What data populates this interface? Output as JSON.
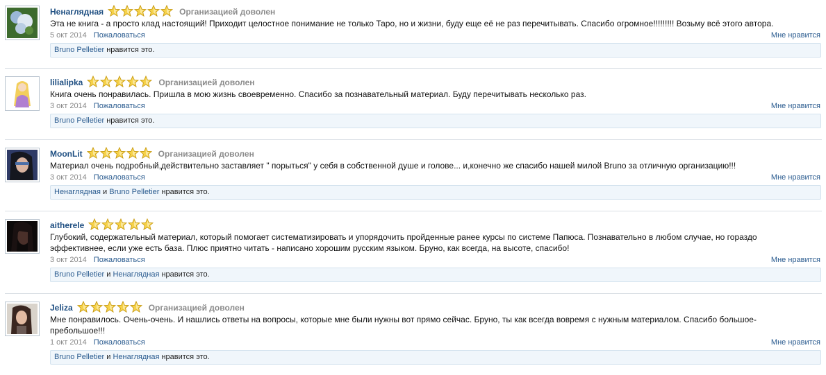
{
  "rating_word_stars": 5,
  "colors": {
    "link": "#2a5b8f",
    "username": "#1f4f82",
    "star": "#f4c430",
    "like_box_bg": "#f0f6fb"
  },
  "reviews": [
    {
      "username": "Ненаглядная",
      "rating": 5,
      "verdict": "Организацией доволен",
      "text_lines": [
        "Эта не книга - а просто клад настоящий! Приходит целостное понимание не только Таро, но и жизни, буду еще её не раз перечитывать. Спасибо огромное!!!!!!!!! Возьму всё этого автора."
      ],
      "date": "5 окт 2014",
      "report": "Пожаловаться",
      "like": "Мне нравится",
      "likers": [
        "Bruno Pelletier"
      ],
      "and": "",
      "likes_suffix": "нравится это.",
      "avatar": "flower-avatar"
    },
    {
      "username": "lilialipka",
      "rating": 5,
      "verdict": "Организацией доволен",
      "text_lines": [
        "Книга очень понравилась. Пришла в мою жизнь своевременно. Спасибо за познавательный материал. Буду перечитывать несколько раз."
      ],
      "date": "3 окт 2014",
      "report": "Пожаловаться",
      "like": "Мне нравится",
      "likers": [
        "Bruno Pelletier"
      ],
      "and": "",
      "likes_suffix": "нравится это.",
      "avatar": "princess-avatar"
    },
    {
      "username": "MoonLit",
      "rating": 5,
      "verdict": "Организацией доволен",
      "text_lines": [
        "Материал очень подробный,действительно заставляет \" порыться\" у себя в собственной душе и голове... и,конечно же спасибо нашей милой Bruno за отличную организацию!!!"
      ],
      "date": "3 окт 2014",
      "report": "Пожаловаться",
      "like": "Мне нравится",
      "likers": [
        "Ненаглядная",
        "Bruno Pelletier"
      ],
      "and": "и",
      "likes_suffix": "нравится это.",
      "avatar": "fantasy-avatar"
    },
    {
      "username": "aitherele",
      "rating": 5,
      "verdict": "",
      "text_lines": [
        "Глубокий, содержательный материал, который помогает систематизировать и упорядочить пройденные ранее курсы по системе Папюса. Познавательно в любом случае, но гораздо",
        "эффективнее, если уже есть база. Плюс приятно читать - написано хорошим русским языком. Бруно, как всегда, на высоте, спасибо!"
      ],
      "date": "3 окт 2014",
      "report": "Пожаловаться",
      "like": "Мне нравится",
      "likers": [
        "Bruno Pelletier",
        "Ненаглядная"
      ],
      "and": "и",
      "likes_suffix": "нравится это.",
      "avatar": "dark-portrait-avatar"
    },
    {
      "username": "Jeliza",
      "rating": 5,
      "verdict": "Организацией доволен",
      "text_lines": [
        "Мне понравилось. Очень-очень. И нашлись ответы на вопросы, которые мне были нужны вот прямо сейчас. Бруно, ты как всегда вовремя с нужным материалом. Спасибо большое-",
        "пребольшое!!!"
      ],
      "date": "1 окт 2014",
      "report": "Пожаловаться",
      "like": "Мне нравится",
      "likers": [
        "Bruno Pelletier",
        "Ненаглядная"
      ],
      "and": "и",
      "likes_suffix": "нравится это.",
      "avatar": "selfie-avatar"
    }
  ]
}
